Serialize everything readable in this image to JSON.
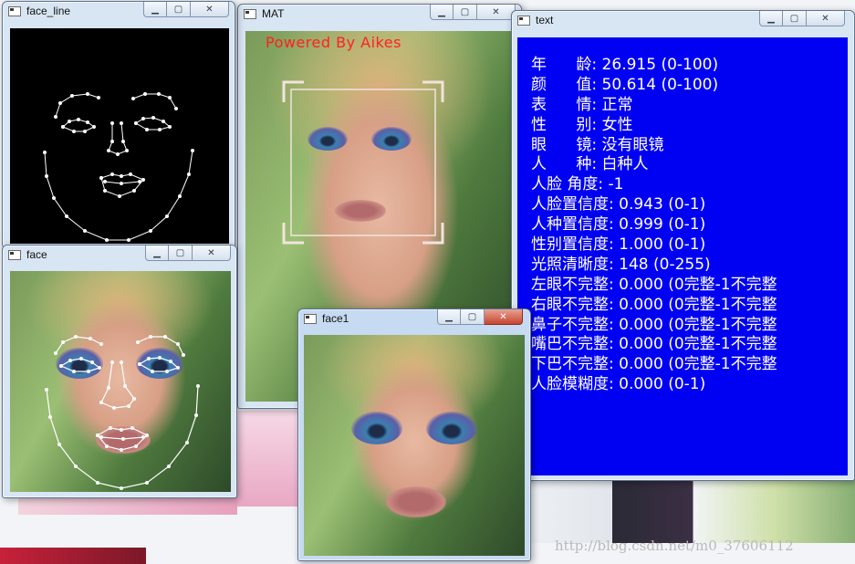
{
  "windows": {
    "face_line": {
      "title": "face_line"
    },
    "mat": {
      "title": "MAT",
      "overlay_text": "Powered By Aikes",
      "overlay_color": "#ff2020"
    },
    "text": {
      "title": "text",
      "background": "#0000f2"
    },
    "face": {
      "title": "face"
    },
    "face1": {
      "title": "face1"
    }
  },
  "attributes": [
    {
      "label": "年      龄:",
      "value": "26.915 (0-100)"
    },
    {
      "label": "颜      值:",
      "value": "50.614 (0-100)"
    },
    {
      "label": "表      情:",
      "value": "正常"
    },
    {
      "label": "性      别:",
      "value": "女性"
    },
    {
      "label": "眼      镜:",
      "value": "没有眼镜"
    },
    {
      "label": "人      种:",
      "value": "白种人"
    },
    {
      "label": "人脸 角度:",
      "value": "-1"
    },
    {
      "label": "人脸置信度:",
      "value": "0.943 (0-1)"
    },
    {
      "label": "人种置信度:",
      "value": "0.999 (0-1)"
    },
    {
      "label": "性别置信度:",
      "value": "1.000 (0-1)"
    },
    {
      "label": "光照清晰度:",
      "value": "148 (0-255)"
    },
    {
      "label": "左眼不完整:",
      "value": "0.000 (0完整-1不完整"
    },
    {
      "label": "右眼不完整:",
      "value": "0.000 (0完整-1不完整"
    },
    {
      "label": "鼻子不完整:",
      "value": "0.000 (0完整-1不完整"
    },
    {
      "label": "嘴巴不完整:",
      "value": "0.000 (0完整-1不完整"
    },
    {
      "label": "下巴不完整:",
      "value": "0.000 (0完整-1不完整"
    },
    {
      "label": "人脸模糊度:",
      "value": "0.000 (0-1)"
    }
  ],
  "watermark": "http://blog.csdn.net/m0_37606112",
  "icons": {
    "minimize": "minimize-icon",
    "maximize": "maximize-icon",
    "close": "close-icon",
    "app": "app-icon"
  }
}
